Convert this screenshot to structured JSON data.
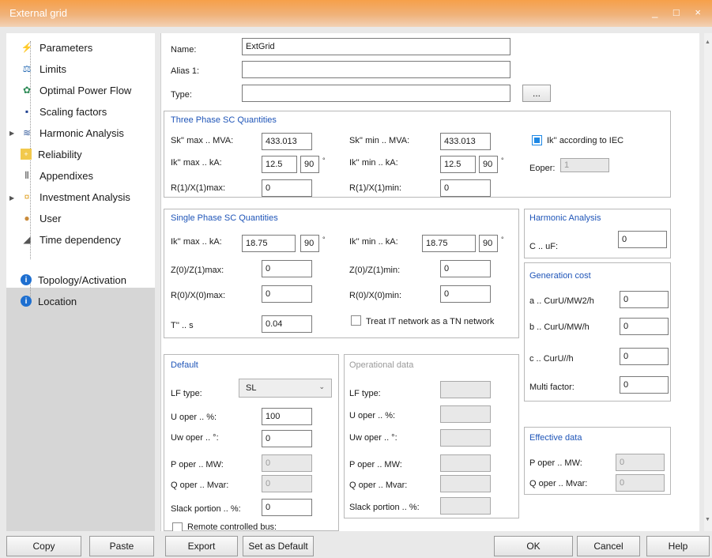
{
  "window": {
    "title": "External grid",
    "controls": "_ □ ×"
  },
  "sidebar": {
    "items": [
      {
        "label": "Parameters",
        "icon": "lightning-icon"
      },
      {
        "label": "Limits",
        "icon": "scales-icon"
      },
      {
        "label": "Optimal Power Flow",
        "icon": "globe-icon"
      },
      {
        "label": "Scaling factors",
        "icon": "scaling-icon"
      },
      {
        "label": "Harmonic Analysis",
        "icon": "harmonic-icon"
      },
      {
        "label": "Reliability",
        "icon": "reliability-icon"
      },
      {
        "label": "Appendixes",
        "icon": "paperclip-icon"
      },
      {
        "label": "Investment Analysis",
        "icon": "money-icon"
      },
      {
        "label": "User",
        "icon": "user-icon"
      },
      {
        "label": "Time dependency",
        "icon": "time-icon"
      },
      {
        "label": "Topology/Activation",
        "icon": "info-icon"
      },
      {
        "label": "Location",
        "icon": "info-icon"
      }
    ]
  },
  "general": {
    "name_label": "Name:",
    "name_value": "ExtGrid",
    "alias_label": "Alias 1:",
    "alias_value": "",
    "type_label": "Type:",
    "type_value": "",
    "browse_label": "..."
  },
  "three_phase": {
    "title": "Three Phase SC Quantities",
    "sk_max_label": "Sk'' max .. MVA:",
    "sk_max": "433.013",
    "sk_min_label": "Sk'' min .. MVA:",
    "sk_min": "433.013",
    "ik_max_label": "Ik'' max .. kA:",
    "ik_max": "12.5",
    "ik_max_angle": "90",
    "ik_min_label": "Ik'' min .. kA:",
    "ik_min": "12.5",
    "ik_min_angle": "90",
    "r1x1_max_label": "R(1)/X(1)max:",
    "r1x1_max": "0",
    "r1x1_min_label": "R(1)/X(1)min:",
    "r1x1_min": "0",
    "iec_label": "Ik'' according to IEC",
    "eoper_label": "Eoper:",
    "eoper": "1",
    "deg": "°"
  },
  "single_phase": {
    "title": "Single Phase SC Quantities",
    "ik_max_label": "Ik'' max .. kA:",
    "ik_max": "18.75",
    "ik_max_angle": "90",
    "ik_min_label": "Ik'' min .. kA:",
    "ik_min": "18.75",
    "ik_min_angle": "90",
    "z0z1_max_label": "Z(0)/Z(1)max:",
    "z0z1_max": "0",
    "z0z1_min_label": "Z(0)/Z(1)min:",
    "z0z1_min": "0",
    "r0x0_max_label": "R(0)/X(0)max:",
    "r0x0_max": "0",
    "r0x0_min_label": "R(0)/X(0)min:",
    "r0x0_min": "0",
    "t_label": "T'' .. s",
    "t": "0.04",
    "tn_label": "Treat IT network as a TN network"
  },
  "harmonic": {
    "title": "Harmonic Analysis",
    "c_label": "C .. uF:",
    "c": "0"
  },
  "generation_cost": {
    "title": "Generation cost",
    "a_label": "a .. CurU/MW2/h",
    "a": "0",
    "b_label": "b .. CurU/MW/h",
    "b": "0",
    "c_label": "c .. CurU//h",
    "c": "0",
    "multi_label": "Multi factor:",
    "multi": "0"
  },
  "default": {
    "title": "Default",
    "lf_label": "LF type:",
    "lf_value": "SL",
    "u_label": "U oper .. %:",
    "u": "100",
    "uw_label": "Uw oper .. °:",
    "uw": "0",
    "p_label": "P oper .. MW:",
    "p": "0",
    "q_label": "Q oper .. Mvar:",
    "q": "0",
    "slack_label": "Slack portion .. %:",
    "slack": "0",
    "remote_label": "Remote controlled bus:"
  },
  "operational": {
    "title": "Operational data",
    "lf_label": "LF type:",
    "u_label": "U oper .. %:",
    "uw_label": "Uw oper .. °:",
    "p_label": "P oper .. MW:",
    "q_label": "Q oper .. Mvar:",
    "slack_label": "Slack portion .. %:"
  },
  "effective": {
    "title": "Effective data",
    "p_label": "P oper .. MW:",
    "p": "0",
    "q_label": "Q oper .. Mvar:",
    "q": "0"
  },
  "buttons": {
    "copy": "Copy",
    "paste": "Paste",
    "export": "Export",
    "set_default": "Set as Default",
    "ok": "OK",
    "cancel": "Cancel",
    "help": "Help"
  }
}
